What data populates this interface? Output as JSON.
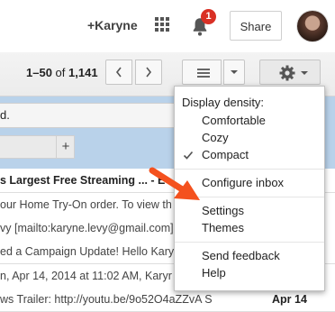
{
  "header": {
    "user_link": "+Karyne",
    "notification_count": "1",
    "share_label": "Share"
  },
  "toolbar": {
    "page_range": "1–50",
    "of_label": "of",
    "total": "1,141"
  },
  "background": {
    "search_text_fragment": "d.",
    "plus_tab": "+",
    "rows": [
      {
        "text": "s Largest Free Streaming ... - E",
        "date": ""
      },
      {
        "text": "our Home Try-On order. To view th",
        "date": ""
      },
      {
        "text": "vy [mailto:karyne.levy@gmail.com]",
        "date": ""
      },
      {
        "text": "ed a Campaign Update! Hello Kary",
        "date": ""
      },
      {
        "text": "n, Apr 14, 2014 at 11:02 AM, Karyr",
        "date": ""
      },
      {
        "text": "ws Trailer: http://youtu.be/9o52O4aZZvA S",
        "date": "Apr 14"
      }
    ]
  },
  "menu": {
    "density_heading": "Display density:",
    "comfortable": "Comfortable",
    "cozy": "Cozy",
    "compact": "Compact",
    "selected_density": "compact",
    "configure_inbox": "Configure inbox",
    "settings": "Settings",
    "themes": "Themes",
    "send_feedback": "Send feedback",
    "help": "Help"
  },
  "colors": {
    "arrow": "#f4511e",
    "badge": "#d93025",
    "list_background": "#b9d2ea"
  }
}
